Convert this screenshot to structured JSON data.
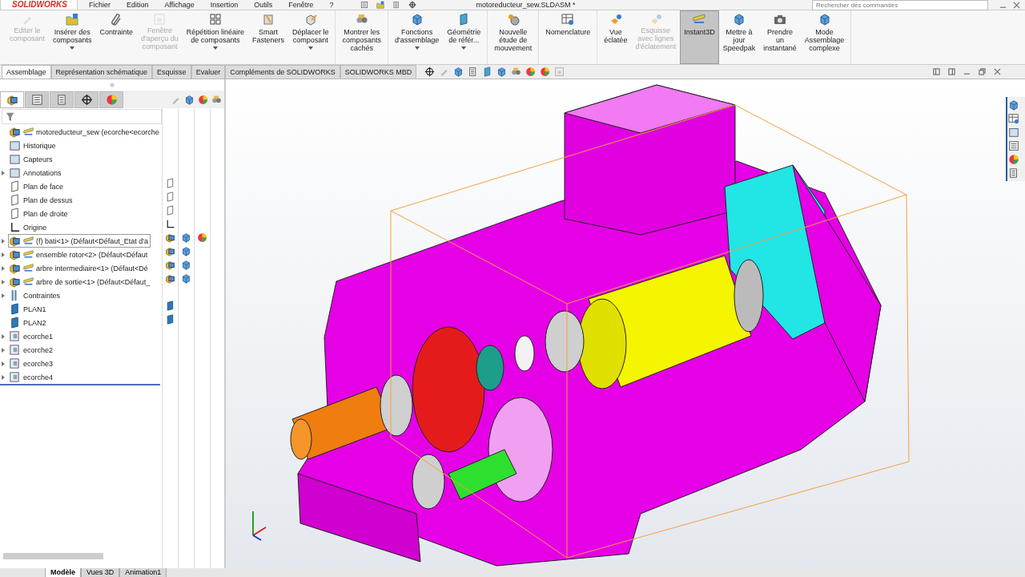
{
  "app": {
    "logo": "SOLIDWORKS",
    "menu": [
      "Fichier",
      "Edition",
      "Affichage",
      "Insertion",
      "Outils",
      "Fenêtre",
      "?"
    ],
    "document_title": "motoreducteur_sew.SLDASM *",
    "search": {
      "placeholder": "Rechercher des commandes"
    }
  },
  "ribbon": {
    "groups": [
      {
        "buttons": [
          {
            "label": "Editer le\ncomposant",
            "disabled": true,
            "selected": false,
            "dropdown": false
          },
          {
            "label": "Insérer des\ncomposants",
            "disabled": false,
            "selected": false,
            "dropdown": true
          },
          {
            "label": "Contrainte",
            "disabled": false,
            "selected": false,
            "dropdown": false
          },
          {
            "label": "Fenêtre\nd'aperçu du\ncomposant",
            "disabled": true,
            "selected": false,
            "dropdown": false
          },
          {
            "label": "Répétition linéaire\nde composants",
            "disabled": false,
            "selected": false,
            "dropdown": true
          },
          {
            "label": "Smart\nFasteners",
            "disabled": false,
            "selected": false,
            "dropdown": false
          },
          {
            "label": "Déplacer le\ncomposant",
            "disabled": false,
            "selected": false,
            "dropdown": true
          }
        ]
      },
      {
        "buttons": [
          {
            "label": "Montrer les\ncomposants\ncachés",
            "disabled": false,
            "selected": false,
            "dropdown": false
          }
        ]
      },
      {
        "buttons": [
          {
            "label": "Fonctions\nd'assemblage",
            "disabled": false,
            "selected": false,
            "dropdown": true
          },
          {
            "label": "Géométrie\nde référ...",
            "disabled": false,
            "selected": false,
            "dropdown": true
          }
        ]
      },
      {
        "buttons": [
          {
            "label": "Nouvelle\nétude de\nmouvement",
            "disabled": false,
            "selected": false,
            "dropdown": false
          }
        ]
      },
      {
        "buttons": [
          {
            "label": "Nomenclature",
            "disabled": false,
            "selected": false,
            "dropdown": false
          }
        ]
      },
      {
        "buttons": [
          {
            "label": "Vue\néclatée",
            "disabled": false,
            "selected": false,
            "dropdown": false
          },
          {
            "label": "Esquisse\navec lignes\nd'éclatement",
            "disabled": true,
            "selected": false,
            "dropdown": false
          },
          {
            "label": "Instant3D",
            "disabled": false,
            "selected": true,
            "dropdown": false
          },
          {
            "label": "Mettre à\njour\nSpeedpak",
            "disabled": false,
            "selected": false,
            "dropdown": false
          },
          {
            "label": "Prendre\nun\ninstantané",
            "disabled": false,
            "selected": false,
            "dropdown": false
          },
          {
            "label": "Mode\nAssemblage\ncomplexe",
            "disabled": false,
            "selected": false,
            "dropdown": false
          }
        ]
      }
    ]
  },
  "tabs": [
    {
      "label": "Assemblage",
      "selected": true
    },
    {
      "label": "Représentation schématique",
      "selected": false
    },
    {
      "label": "Esquisse",
      "selected": false
    },
    {
      "label": "Evaluer",
      "selected": false
    },
    {
      "label": "Compléments de SOLIDWORKS",
      "selected": false
    },
    {
      "label": "SOLIDWORKS MBD",
      "selected": false
    }
  ],
  "feature_tree": {
    "panel_tabs": [
      {
        "selected": true
      },
      {
        "selected": false
      },
      {
        "selected": false
      },
      {
        "selected": false
      },
      {
        "selected": false
      }
    ],
    "items": [
      {
        "label": "motoreducteur_sew  (ecorche<ecorche",
        "kind": "assembly",
        "expandable": false,
        "selected": false
      },
      {
        "label": "Historique",
        "kind": "folder",
        "expandable": false,
        "selected": false
      },
      {
        "label": "Capteurs",
        "kind": "folder",
        "expandable": false,
        "selected": false
      },
      {
        "label": "Annotations",
        "kind": "folder",
        "expandable": true,
        "selected": false
      },
      {
        "label": "Plan de face",
        "kind": "plane",
        "expandable": false,
        "selected": false
      },
      {
        "label": "Plan de dessus",
        "kind": "plane",
        "expandable": false,
        "selected": false
      },
      {
        "label": "Plan de droite",
        "kind": "plane",
        "expandable": false,
        "selected": false
      },
      {
        "label": "Origine",
        "kind": "origin",
        "expandable": false,
        "selected": false
      },
      {
        "label": "(f) bati<1> (Défaut<Défaut_Etat d'a",
        "kind": "component",
        "expandable": true,
        "selected": true
      },
      {
        "label": "ensemble rotor<2> (Défaut<Défaut",
        "kind": "component",
        "expandable": true,
        "selected": false
      },
      {
        "label": "arbre intermediaire<1> (Défaut<Dé",
        "kind": "component",
        "expandable": true,
        "selected": false
      },
      {
        "label": "arbre de sortie<1> (Défaut<Défaut_",
        "kind": "component",
        "expandable": true,
        "selected": false
      },
      {
        "label": "Contraintes",
        "kind": "mates",
        "expandable": true,
        "selected": false
      },
      {
        "label": "PLAN1",
        "kind": "solid-plane",
        "expandable": false,
        "selected": false
      },
      {
        "label": "PLAN2",
        "kind": "solid-plane",
        "expandable": false,
        "selected": false
      },
      {
        "label": "ecorche1",
        "kind": "section",
        "expandable": true,
        "selected": false
      },
      {
        "label": "ecorche2",
        "kind": "section",
        "expandable": true,
        "selected": false
      },
      {
        "label": "ecorche3",
        "kind": "section",
        "expandable": true,
        "selected": false
      },
      {
        "label": "ecorche4",
        "kind": "section",
        "expandable": true,
        "selected": false
      }
    ]
  },
  "bottom_tabs": [
    {
      "label": "Modèle",
      "selected": true
    },
    {
      "label": "Vues 3D",
      "selected": false
    },
    {
      "label": "Animation1",
      "selected": false
    }
  ]
}
